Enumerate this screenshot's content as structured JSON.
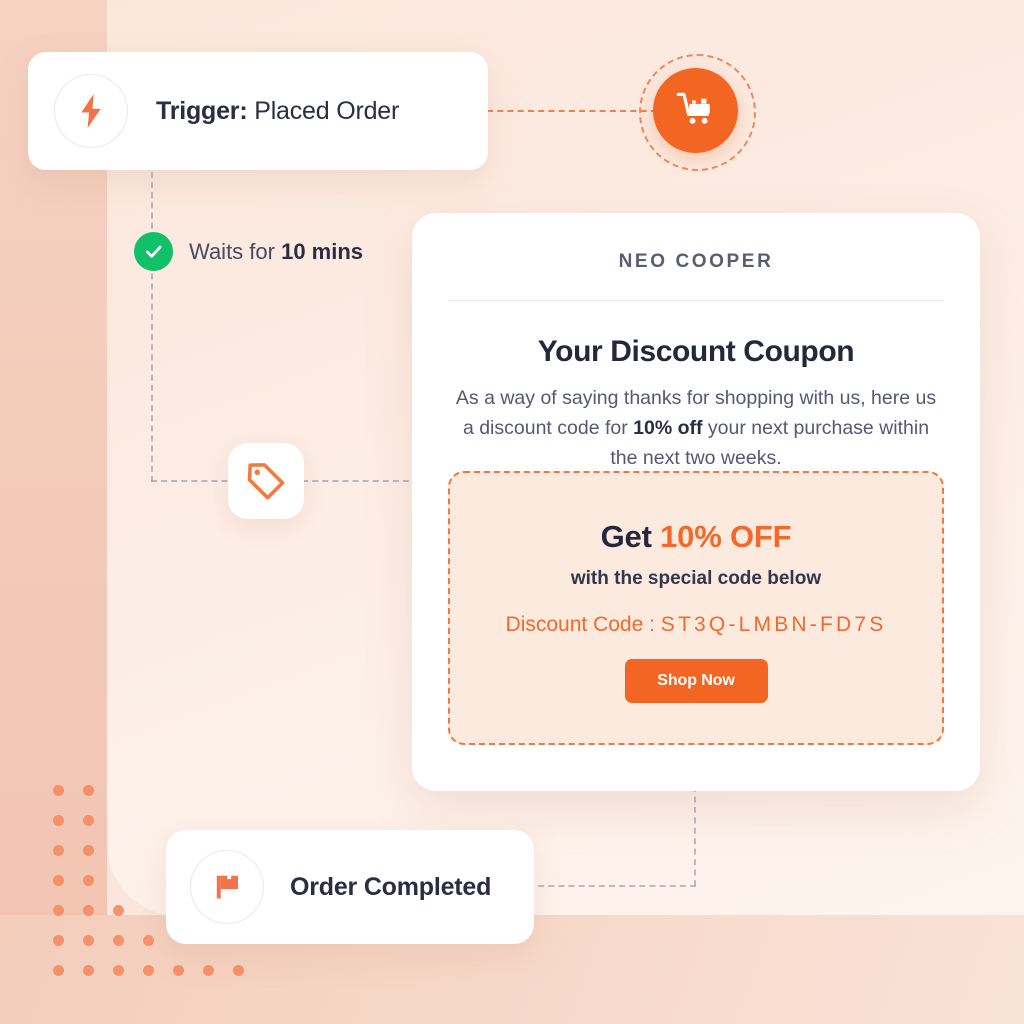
{
  "flow": {
    "trigger": {
      "icon": "lightning-bolt-icon",
      "label_bold": "Trigger:",
      "label_rest": " Placed Order"
    },
    "wait_step": {
      "icon": "check-circle-icon",
      "prefix": "Waits for ",
      "duration": "10 mins"
    },
    "cart_node": {
      "icon": "shopping-cart-icon"
    },
    "tag_node": {
      "icon": "price-tag-icon"
    },
    "order_completed": {
      "icon": "flag-icon",
      "label": "Order Completed"
    }
  },
  "coupon": {
    "brand": "NEO COOPER",
    "title": "Your Discount Coupon",
    "desc_part1": "As a way of saying thanks for shopping with us, here us a discount code for ",
    "desc_bold": "10% off",
    "desc_part2": " your next purchase within the next two weeks.",
    "offer_prefix": "Get ",
    "offer_highlight": "10% OFF",
    "offer_sub": "with the special code below",
    "code_label": "Discount Code : ",
    "code_value": "ST3Q-LMBN-FD7S",
    "cta_label": "Shop Now"
  },
  "colors": {
    "accent_orange": "#f26522",
    "code_orange": "#f4692b",
    "success_green": "#13c06a",
    "text_dark": "#25273c",
    "text_muted": "#555874",
    "coupon_bg": "#fdeade"
  }
}
